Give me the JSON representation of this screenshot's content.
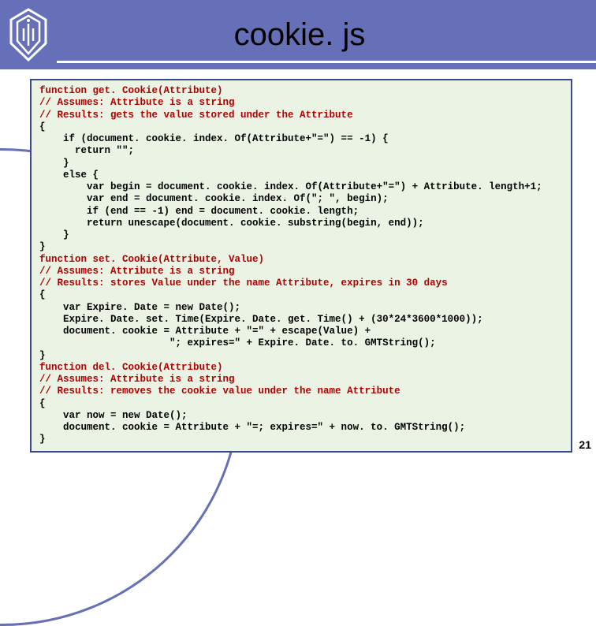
{
  "header": {
    "title": "cookie. js"
  },
  "code": {
    "lines": [
      {
        "cls": "kw",
        "text": "function get. Cookie(Attribute)"
      },
      {
        "cls": "kw",
        "text": "// Assumes: Attribute is a string"
      },
      {
        "cls": "kw",
        "text": "// Results: gets the value stored under the Attribute"
      },
      {
        "cls": "txt",
        "text": "{"
      },
      {
        "cls": "txt",
        "text": "    if (document. cookie. index. Of(Attribute+\"=\") == -1) {"
      },
      {
        "cls": "txt",
        "text": "      return \"\";"
      },
      {
        "cls": "txt",
        "text": "    }"
      },
      {
        "cls": "txt",
        "text": "    else {"
      },
      {
        "cls": "txt",
        "text": "        var begin = document. cookie. index. Of(Attribute+\"=\") + Attribute. length+1;"
      },
      {
        "cls": "txt",
        "text": "        var end = document. cookie. index. Of(\"; \", begin);"
      },
      {
        "cls": "txt",
        "text": "        if (end == -1) end = document. cookie. length;"
      },
      {
        "cls": "txt",
        "text": "        return unescape(document. cookie. substring(begin, end));"
      },
      {
        "cls": "txt",
        "text": "    }"
      },
      {
        "cls": "txt",
        "text": "}"
      },
      {
        "cls": "kw",
        "text": "function set. Cookie(Attribute, Value)"
      },
      {
        "cls": "kw",
        "text": "// Assumes: Attribute is a string"
      },
      {
        "cls": "kw",
        "text": "// Results: stores Value under the name Attribute, expires in 30 days"
      },
      {
        "cls": "txt",
        "text": "{"
      },
      {
        "cls": "txt",
        "text": "    var Expire. Date = new Date();"
      },
      {
        "cls": "txt",
        "text": "    Expire. Date. set. Time(Expire. Date. get. Time() + (30*24*3600*1000));"
      },
      {
        "cls": "txt",
        "text": "    document. cookie = Attribute + \"=\" + escape(Value) +"
      },
      {
        "cls": "txt",
        "text": "                      \"; expires=\" + Expire. Date. to. GMTString();"
      },
      {
        "cls": "txt",
        "text": "}"
      },
      {
        "cls": "kw",
        "text": "function del. Cookie(Attribute)"
      },
      {
        "cls": "kw",
        "text": "// Assumes: Attribute is a string"
      },
      {
        "cls": "kw",
        "text": "// Results: removes the cookie value under the name Attribute"
      },
      {
        "cls": "txt",
        "text": "{"
      },
      {
        "cls": "txt",
        "text": "    var now = new Date();"
      },
      {
        "cls": "txt",
        "text": "    document. cookie = Attribute + \"=; expires=\" + now. to. GMTString();"
      },
      {
        "cls": "txt",
        "text": "}"
      }
    ]
  },
  "page_number": "21"
}
